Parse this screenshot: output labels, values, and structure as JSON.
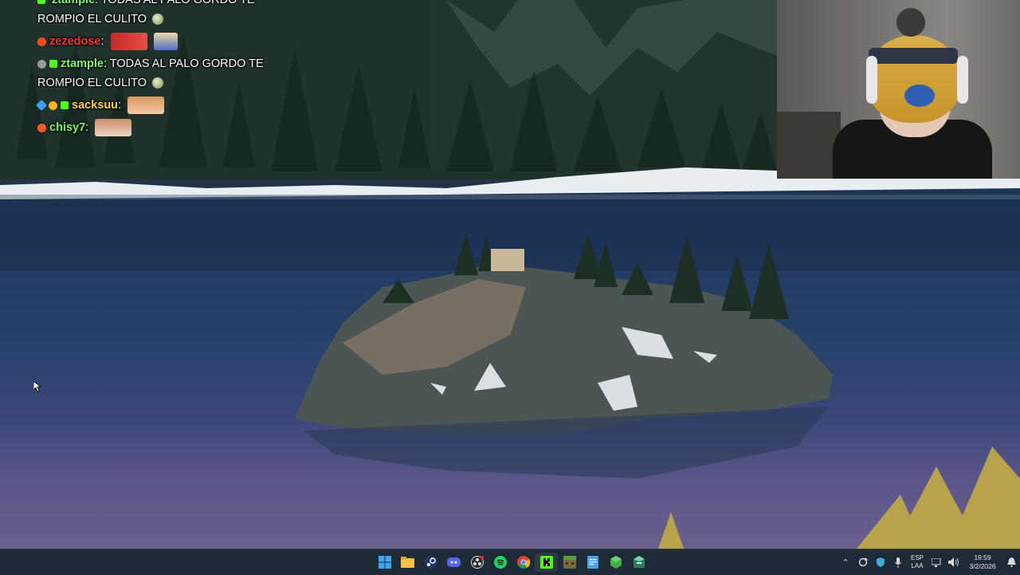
{
  "chat": {
    "messages": [
      {
        "user": "ztample",
        "text": "TODAS AL PALO GORDO TE ROMPIO EL CULITO",
        "user_color": "#7CFC5A"
      },
      {
        "user": "zezedose",
        "text": "",
        "user_color": "#ff3030"
      },
      {
        "user": "ztample",
        "text": "TODAS AL PALO GORDO TE ROMPIO EL CULITO",
        "user_color": "#7CFC5A"
      },
      {
        "user": "sacksuu",
        "text": "",
        "user_color": "#ffd23a"
      },
      {
        "user": "chisy7",
        "text": "",
        "user_color": "#7CFC5A"
      }
    ]
  },
  "taskbar": {
    "apps": [
      {
        "name": "start",
        "icon": "windows-icon"
      },
      {
        "name": "file-explorer",
        "icon": "folder-icon"
      },
      {
        "name": "steam",
        "icon": "steam-icon"
      },
      {
        "name": "discord",
        "icon": "discord-icon"
      },
      {
        "name": "obs",
        "icon": "obs-icon"
      },
      {
        "name": "spotify",
        "icon": "spotify-icon"
      },
      {
        "name": "chrome",
        "icon": "chrome-icon"
      },
      {
        "name": "kick",
        "icon": "kick-icon"
      },
      {
        "name": "minecraft",
        "icon": "minecraft-icon"
      },
      {
        "name": "notepad",
        "icon": "notepad-icon"
      },
      {
        "name": "app-green",
        "icon": "green-cube-icon"
      },
      {
        "name": "app-installer",
        "icon": "package-icon"
      }
    ],
    "tray": {
      "language_line1": "ESP",
      "language_line2": "LAA",
      "time": "19:59",
      "date": "3/2/2026"
    }
  },
  "colors": {
    "taskbar_bg": "#1f2a37",
    "accent": "#53fc18"
  }
}
